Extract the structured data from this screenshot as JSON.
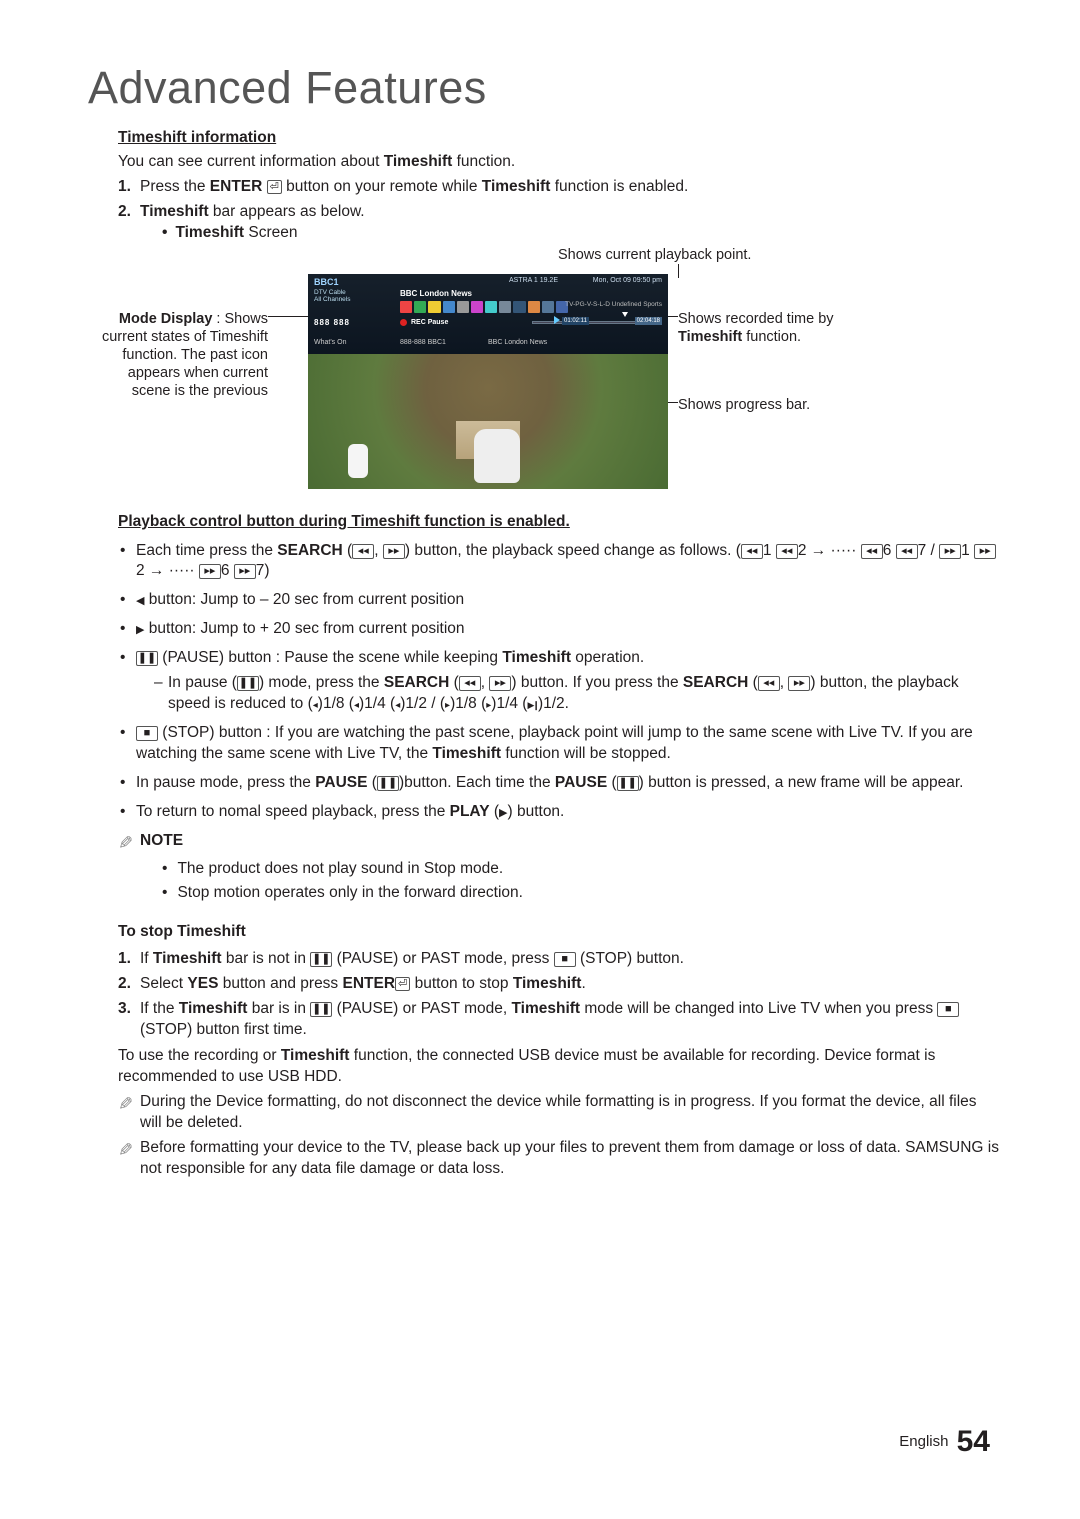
{
  "title": "Advanced Features",
  "s1": {
    "heading": "Timeshift information",
    "intro_pre": "You can see current information about ",
    "intro_bold": "Timeshift",
    "intro_post": " function.",
    "step1_a": "Press the ",
    "step1_b": "ENTER",
    "step1_c": " button on your remote while ",
    "step1_d": "Timeshift",
    "step1_e": " function is enabled.",
    "step2_a": "Timeshift",
    "step2_b": " bar appears as below.",
    "sub_a": "Timeshift",
    "sub_b": " Screen"
  },
  "callouts": {
    "top": "Shows current playback point.",
    "left_a": "Mode Display",
    "left_b": " : Shows current states of Timeshift function. The past icon appears when current scene is the previous",
    "right1_a": "Shows recorded time by ",
    "right1_b": "Timeshift",
    "right1_c": " function.",
    "right2": "Shows progress bar."
  },
  "shot": {
    "channel": "BBC1",
    "astra": "ASTRA 1 19.2E",
    "date": "Mon, Oct 09  09:50 pm",
    "prog": "BBC London News",
    "dtv": "DTV Cable",
    "allch": "All Channels",
    "pvsl": "TV-PG-V-S-L-D   Undefined   Sports",
    "nums": "888  888",
    "rec": "REC Pause",
    "t1": "01:02:11",
    "t2": "02:04:18",
    "wo": "What's On",
    "ch2": "888-888  BBC1",
    "prog2": "BBC London News"
  },
  "s2": {
    "heading": "Playback control button during Timeshift function is enabled.",
    "b1_a": "Each time press the ",
    "b1_b": "SEARCH",
    "b1_c": " button, the playback speed change as follows. (",
    "b1_seq": [
      "1",
      "2 →  ·····",
      "6",
      "7"
    ],
    "b1_seq2": [
      "1",
      "2 →  ·····",
      "6",
      "7"
    ],
    "b2": " button: Jump to – 20 sec from current position",
    "b3": " button: Jump to + 20 sec from current position",
    "b4_a": " (PAUSE) button : Pause the scene while keeping ",
    "b4_b": "Timeshift",
    "b4_c": " operation.",
    "b4s_a": "In pause (",
    "b4s_b": ") mode, press the ",
    "b4s_c": "SEARCH",
    "b4s_d": " button. If you press the ",
    "b4s_e": "SEARCH",
    "b4s_f": " button, the playback speed is reduced to (",
    "b4s_seq": ")1/8 (",
    "b4s_seq2": ")1/4 (",
    "b4s_seq3": ")1/2 / (",
    "b4s_seq4": ")1/8 (",
    "b4s_seq5": ")1/4 (",
    "b4s_seq6": ")1/2.",
    "b5_a": " (STOP) button : If you are watching the past scene, playback point will jump to the same scene with Live TV. If you are watching the same scene with Live TV, the ",
    "b5_b": "Timeshift",
    "b5_c": " function will be stopped.",
    "b6_a": "In pause mode, press the ",
    "b6_b": "PAUSE",
    "b6_c": "button. Each time the ",
    "b6_d": "PAUSE",
    "b6_e": " button is pressed, a new frame will be appear.",
    "b7_a": "To return to nomal speed playback, press the ",
    "b7_b": "PLAY",
    "b7_c": " button."
  },
  "note": {
    "label": "NOTE",
    "n1": "The product does not play sound in Stop mode.",
    "n2": "Stop motion operates only in the forward direction."
  },
  "s3": {
    "heading": "To stop Timeshift",
    "st1_a": "If ",
    "st1_b": "Timeshift",
    "st1_c": " bar is not in ",
    "st1_d": " (PAUSE) or PAST mode, press ",
    "st1_e": " (STOP) button.",
    "st2_a": "Select ",
    "st2_b": "YES",
    "st2_c": " button and press ",
    "st2_d": "ENTER",
    "st2_e": " button to stop ",
    "st2_f": "Timeshift",
    "st2_g": ".",
    "st3_a": "If the ",
    "st3_b": "Timeshift",
    "st3_c": " bar is in ",
    "st3_d": " (PAUSE) or PAST mode, ",
    "st3_e": "Timeshift",
    "st3_f": " mode will be changed into Live TV when you press ",
    "st3_g": " (STOP) button first time."
  },
  "tail_a": "To use the recording or ",
  "tail_b": "Timeshift",
  "tail_c": " function, the connected USB device must be available for recording. Device format is recommended to use USB HDD.",
  "tnote1": "During the Device formatting, do not disconnect the device while formatting is in progress. If you format the device, all files will be deleted.",
  "tnote2": "Before formatting your device to the TV, please back up your files to prevent them from damage or loss of data. SAMSUNG is not responsible for any data file damage or data loss.",
  "footer": {
    "lang": "English",
    "page": "54"
  }
}
